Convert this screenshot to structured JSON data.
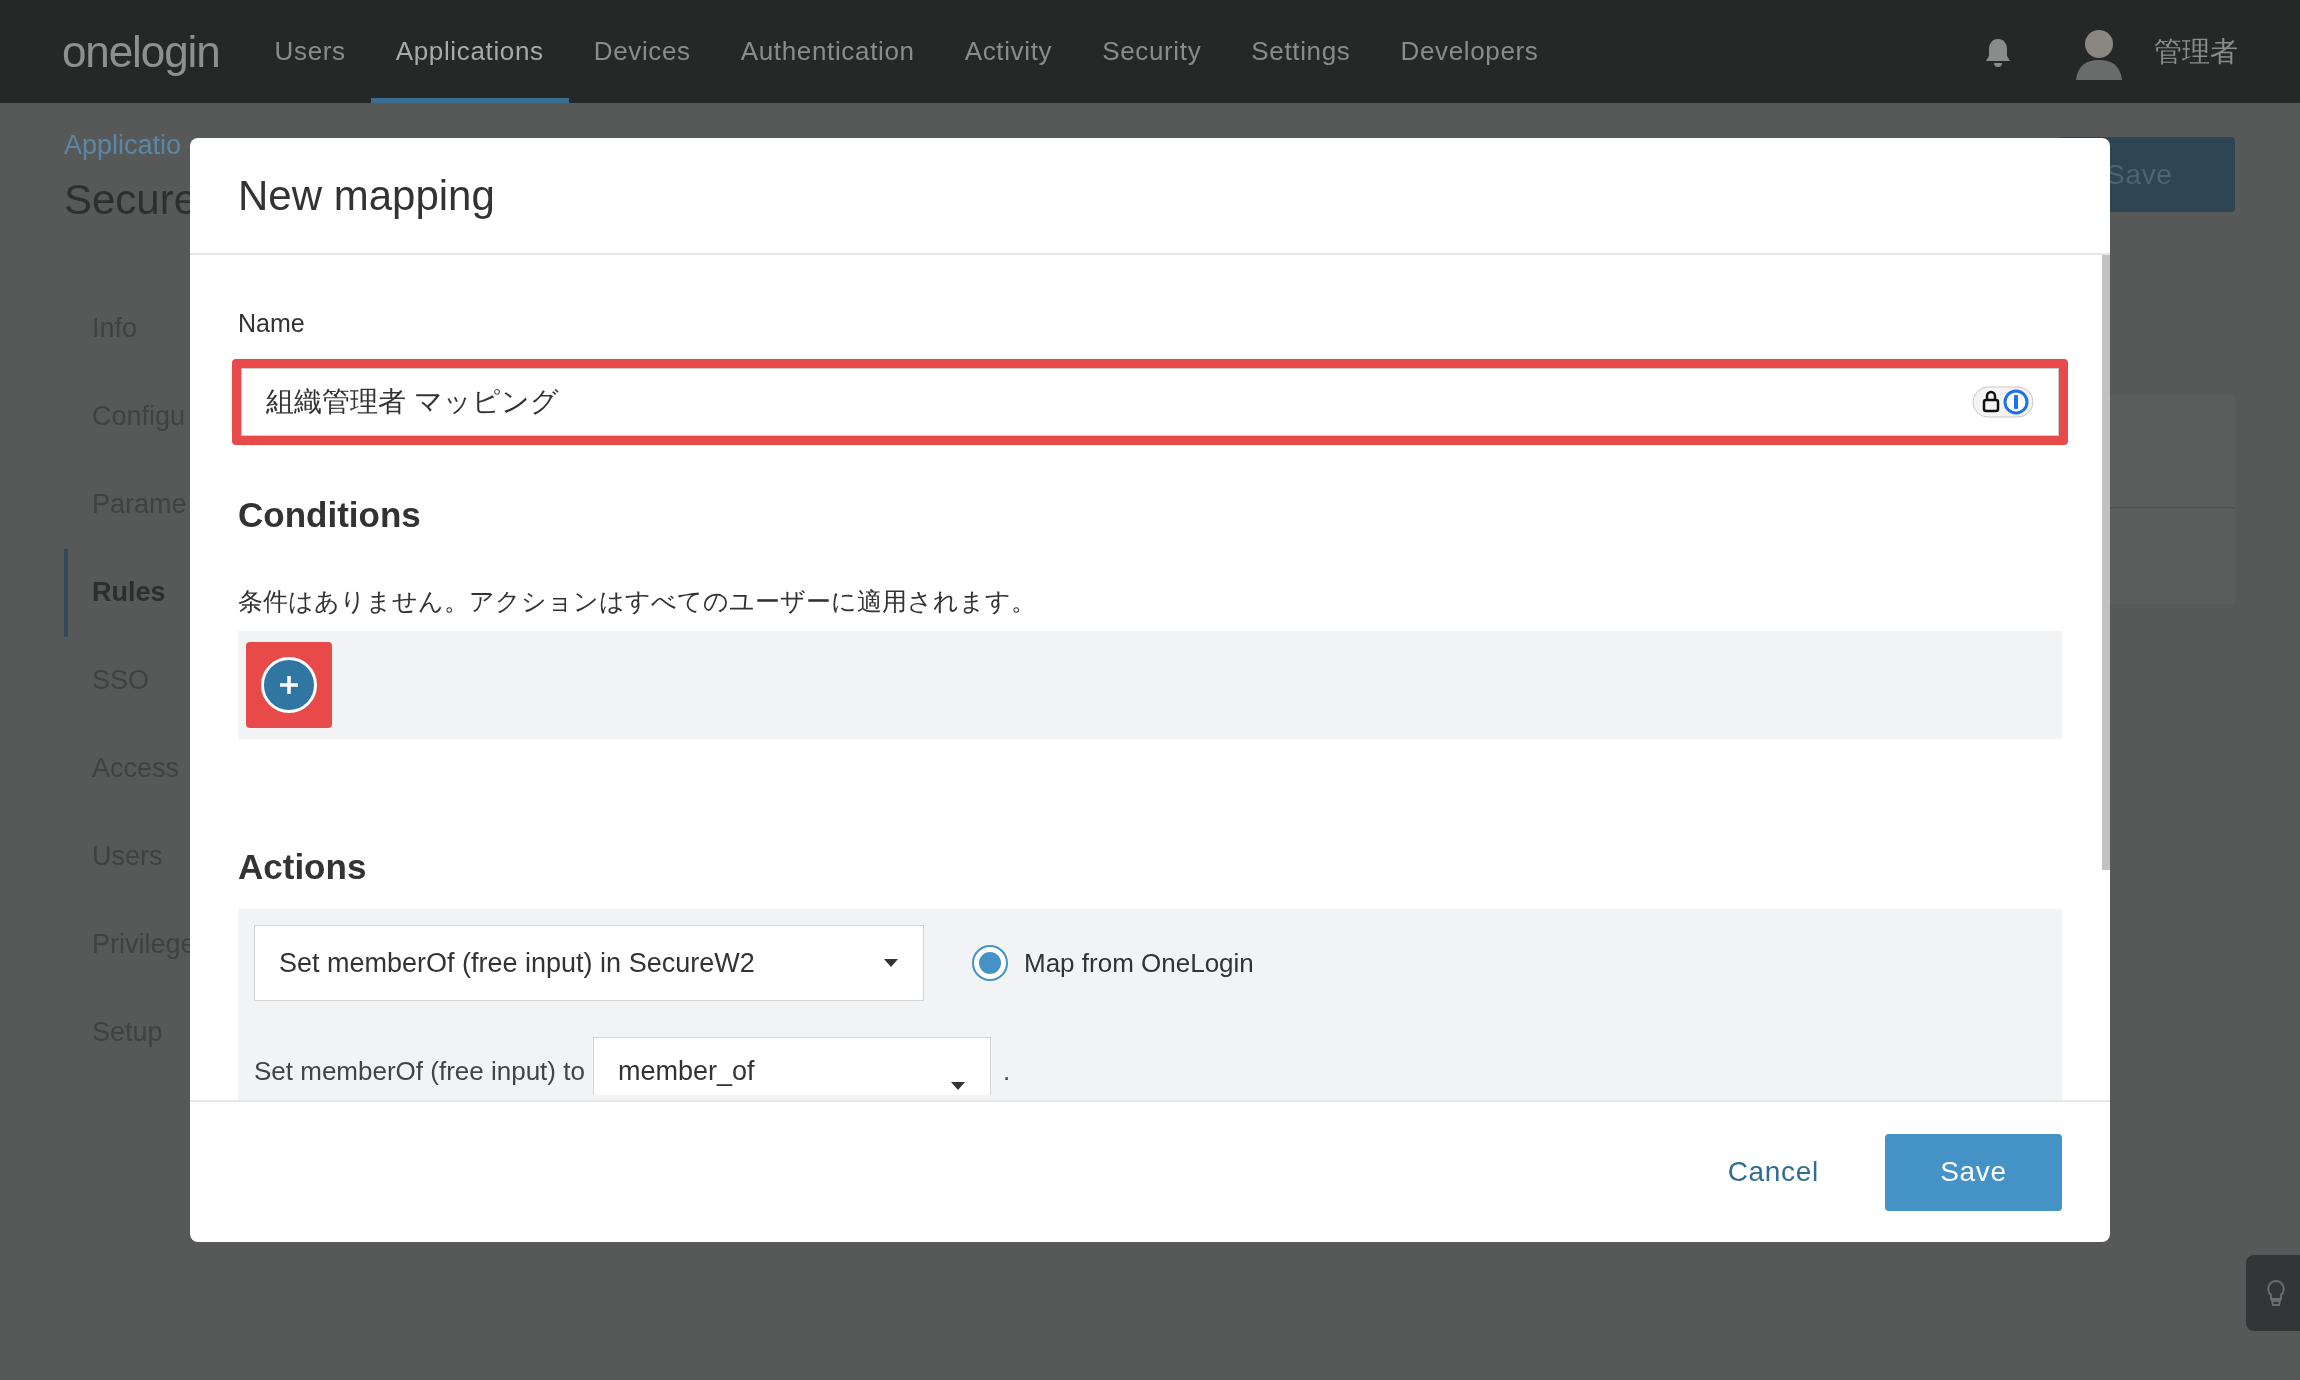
{
  "nav": {
    "logo": "onelogin",
    "items": [
      {
        "label": "Users",
        "selected": false
      },
      {
        "label": "Applications",
        "selected": true
      },
      {
        "label": "Devices",
        "selected": false
      },
      {
        "label": "Authentication",
        "selected": false
      },
      {
        "label": "Activity",
        "selected": false
      },
      {
        "label": "Security",
        "selected": false
      },
      {
        "label": "Settings",
        "selected": false
      },
      {
        "label": "Developers",
        "selected": false
      }
    ],
    "user": "管理者"
  },
  "page": {
    "breadcrumb": "Applicatio",
    "title": "Secure",
    "save_button": "Save",
    "sidebar": [
      {
        "label": "Info",
        "selected": false
      },
      {
        "label": "Configu",
        "selected": false
      },
      {
        "label": "Parame",
        "selected": false
      },
      {
        "label": "Rules",
        "selected": true
      },
      {
        "label": "SSO",
        "selected": false
      },
      {
        "label": "Access",
        "selected": false
      },
      {
        "label": "Users",
        "selected": false
      },
      {
        "label": "Privilege",
        "selected": false
      },
      {
        "label": "Setup",
        "selected": false
      }
    ]
  },
  "modal": {
    "title": "New mapping",
    "name": {
      "label": "Name",
      "value": "組織管理者 マッピング",
      "highlighted": true
    },
    "conditions": {
      "heading": "Conditions",
      "empty_text": "条件はありません。アクションはすべてのユーザーに適用されます。",
      "add_highlighted": true
    },
    "actions": {
      "heading": "Actions",
      "action_select": "Set memberOf (free input) in SecureW2",
      "radio": {
        "label": "Map from OneLogin",
        "selected": true
      },
      "value_label": "Set memberOf (free input) to",
      "value_select": "member_of",
      "suffix": "."
    },
    "buttons": {
      "cancel": "Cancel",
      "save": "Save"
    }
  }
}
